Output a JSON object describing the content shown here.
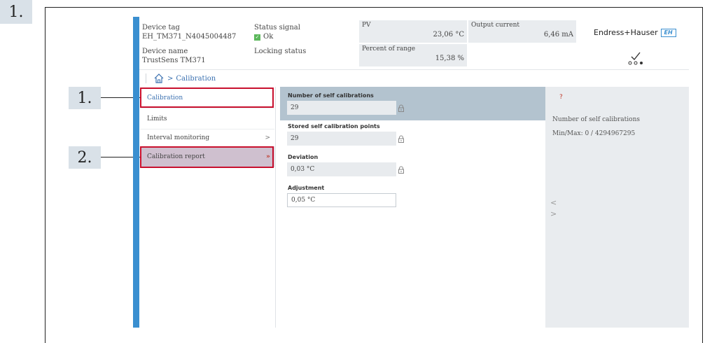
{
  "steps": {
    "main": "1.",
    "step1": "1.",
    "step2": "2."
  },
  "header": {
    "device_tag_label": "Device tag",
    "device_tag_value": "EH_TM371_N4045004487",
    "device_name_label": "Device name",
    "device_name_value": "TrustSens TM371",
    "status_signal_label": "Status signal",
    "status_signal_value": "Ok",
    "locking_status_label": "Locking status",
    "pv_label": "PV",
    "pv_value": "23,06 °C",
    "percent_label": "Percent of range",
    "percent_value": "15,38 %",
    "output_label": "Output current",
    "output_value": "6,46 mA",
    "brand": "Endress+Hauser",
    "brand_mark": "EH"
  },
  "breadcrumb": {
    "separator": ">",
    "current": "Calibration"
  },
  "nav": {
    "items": [
      {
        "label": "Calibration",
        "arrow": ""
      },
      {
        "label": "Limits",
        "arrow": ""
      },
      {
        "label": "Interval monitoring",
        "arrow": ">"
      },
      {
        "label": "Calibration report",
        "arrow": "»"
      }
    ]
  },
  "main": {
    "fields": [
      {
        "label": "Number of self calibrations",
        "value": "29",
        "locked": true
      },
      {
        "label": "Stored self calibration points",
        "value": "29",
        "locked": true
      },
      {
        "label": "Deviation",
        "value": "0,03 °C",
        "locked": true
      },
      {
        "label": "Adjustment",
        "value": "0,05 °C",
        "locked": false
      }
    ]
  },
  "help": {
    "icon": "?",
    "title": "Number of self calibrations",
    "range": "Min/Max: 0 / 4294967295",
    "prev": "<",
    "next": ">"
  },
  "colors": {
    "accent_blue": "#3a8fd0",
    "highlight_red": "#c8102e",
    "status_green": "#5cb85c"
  }
}
